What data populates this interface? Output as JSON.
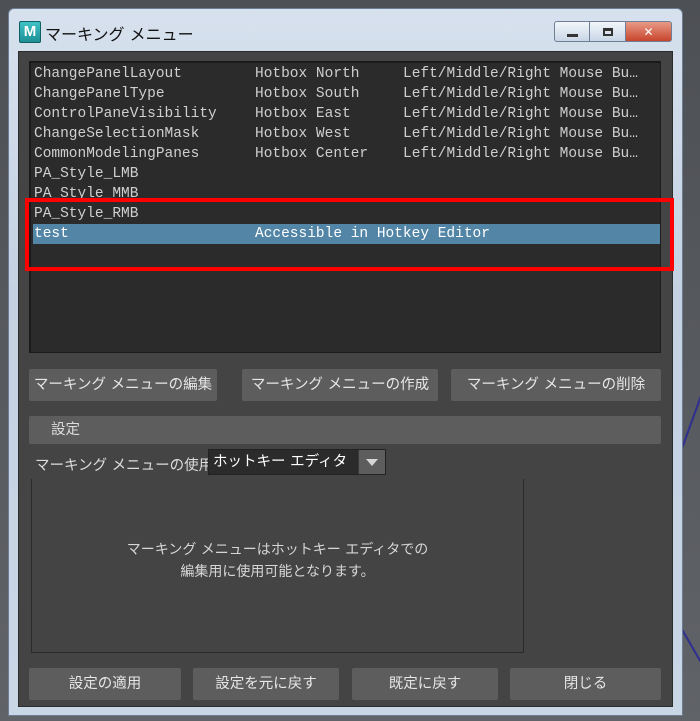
{
  "window": {
    "title": "マーキング メニュー",
    "app_icon_letter": "M"
  },
  "list": {
    "rows": [
      {
        "name": "ChangePanelLayout",
        "hotbox": "Hotbox North",
        "access": "Left/Middle/Right Mouse Bu…"
      },
      {
        "name": "ChangePanelType",
        "hotbox": "Hotbox South",
        "access": "Left/Middle/Right Mouse Bu…"
      },
      {
        "name": "ControlPaneVisibility",
        "hotbox": "Hotbox East",
        "access": "Left/Middle/Right Mouse Bu…"
      },
      {
        "name": "ChangeSelectionMask",
        "hotbox": "Hotbox West",
        "access": "Left/Middle/Right Mouse Bu…"
      },
      {
        "name": "CommonModelingPanes",
        "hotbox": "Hotbox Center",
        "access": "Left/Middle/Right Mouse Bu…"
      },
      {
        "name": "PA_Style_LMB",
        "hotbox": "",
        "access": ""
      },
      {
        "name": "PA_Style_MMB",
        "hotbox": "",
        "access": ""
      },
      {
        "name": "PA_Style_RMB",
        "hotbox": "",
        "access": ""
      },
      {
        "name": "test",
        "hotbox": "Accessible in Hotkey Editor",
        "access": ""
      }
    ],
    "selected_index": 8
  },
  "actions": {
    "edit": "マーキング メニューの編集",
    "create": "マーキング メニューの作成",
    "delete": "マーキング メニューの削除"
  },
  "settings": {
    "header": "設定",
    "use_label": "マーキング メニューの使用:",
    "use_value": "ホットキー エディタ",
    "info_line1": "マーキング メニューはホットキー エディタでの",
    "info_line2": "編集用に使用可能となります。"
  },
  "footer": {
    "apply": "設定の適用",
    "revert": "設定を元に戻す",
    "reset": "既定に戻す",
    "close": "閉じる"
  },
  "colors": {
    "selection": "#5285a6",
    "annotation": "#ff0000",
    "panel": "#444444"
  }
}
